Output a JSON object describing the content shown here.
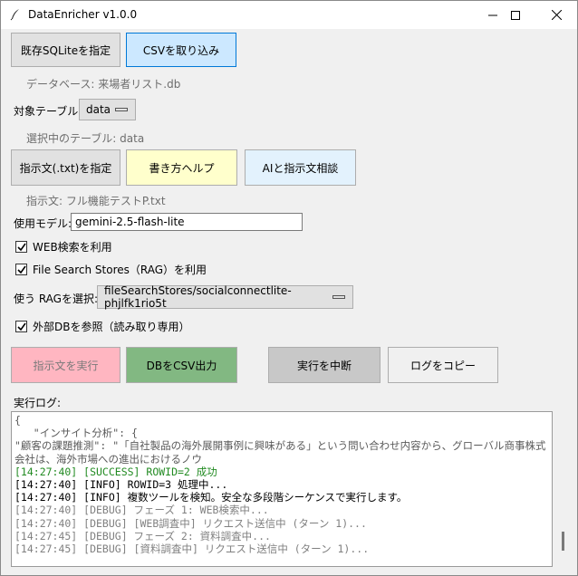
{
  "window": {
    "title": "DataEnricher v1.0.0",
    "controls": [
      "minimize",
      "maximize",
      "close"
    ]
  },
  "db_buttons": {
    "select_sqlite": "既存SQLiteを指定",
    "import_csv": "CSVを取り込み"
  },
  "database_label": "データベース: 来場者リスト.db",
  "table": {
    "label": "対象テーブル:",
    "selected": "data",
    "selected_info": "選択中のテーブル: data"
  },
  "instruction_buttons": {
    "select_txt": "指示文(.txt)を指定",
    "help": "書き方ヘルプ",
    "ai_consult": "AIと指示文相談"
  },
  "instruction_label": "指示文: フル機能テストP.txt",
  "model": {
    "label": "使用モデル:",
    "value": "gemini-2.5-flash-lite"
  },
  "checkboxes": {
    "web_search": "WEB検索を利用",
    "file_search": "File Search Stores（RAG）を利用",
    "external_db": "外部DBを参照（読み取り専用）"
  },
  "rag": {
    "label": "使う RAGを選択:",
    "selected": "fileSearchStores/socialconnectlite-phjlfk1rio5t"
  },
  "action_buttons": {
    "run": "指示文を実行",
    "export_csv": "DBをCSV出力",
    "stop": "実行を中断",
    "copy_log": "ログをコピー"
  },
  "log": {
    "label": "実行ログ:",
    "lines": [
      {
        "type": "normal",
        "text": "{"
      },
      {
        "type": "normal",
        "text": "   \"インサイト分析\": {"
      },
      {
        "type": "normal",
        "text": "     \"顧客の課題推測\": \"「自社製品の海外展開事例に興味がある」という問い合わせ内容から、グローバル商事株式会社は、海外市場への進出におけるノウ",
        "wrap": true
      },
      {
        "type": "success",
        "text": "[14:27:40] [SUCCESS] ROWID=2 成功"
      },
      {
        "type": "info",
        "text": "[14:27:40] [INFO] ROWID=3 処理中..."
      },
      {
        "type": "info",
        "text": "[14:27:40] [INFO] 複数ツールを検知。安全な多段階シーケンスで実行します。"
      },
      {
        "type": "debug",
        "text": "[14:27:40] [DEBUG] フェーズ 1: WEB検索中..."
      },
      {
        "type": "debug",
        "text": "[14:27:40] [DEBUG] [WEB調査中] リクエスト送信中 (ターン 1)..."
      },
      {
        "type": "debug",
        "text": "[14:27:45] [DEBUG] フェーズ 2: 資料調査中..."
      },
      {
        "type": "debug",
        "text": "[14:27:45] [DEBUG] [資料調査中] リクエスト送信中 (ターン 1)..."
      }
    ]
  },
  "colors": {
    "csv_button": "#cce8ff",
    "help_button": "#ffffcc",
    "ai_button": "#e3f2fd",
    "run_button": "#ffb6c1",
    "export_button": "#82b882",
    "stop_button": "#c8c8c8",
    "copy_button": "#f0f0f0",
    "success_log": "#228b22"
  }
}
